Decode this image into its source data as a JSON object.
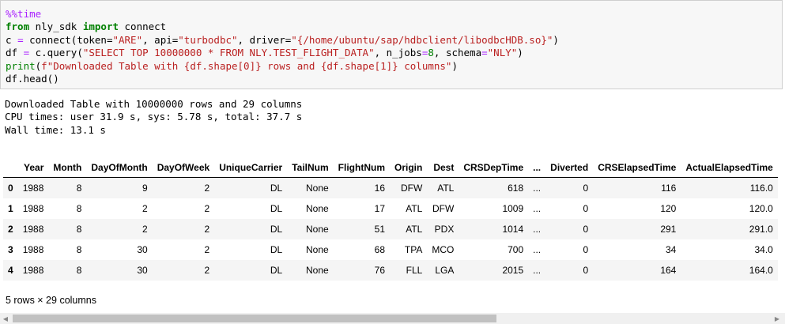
{
  "code": {
    "magic": "%%time",
    "line2": {
      "kw1": "from",
      "module": " nly_sdk ",
      "kw2": "import",
      "name": " connect"
    },
    "line3": {
      "prefix": "c ",
      "eq": "=",
      "pre": " connect(token=",
      "token": "\"ARE\"",
      "sep1": ", api=",
      "api": "\"turbodbc\"",
      "sep2": ", driver=",
      "driver": "\"{/home/ubuntu/sap/hdbclient/libodbcHDB.so}\"",
      "end": ")"
    },
    "line4": {
      "prefix": "df ",
      "eq": "=",
      "pre": " c.query(",
      "query": "\"SELECT TOP 10000000 * FROM NLY.TEST_FLIGHT_DATA\"",
      "sep1": ", n_jobs",
      "eq2": "=",
      "jobs": "8",
      "sep2": ", schema",
      "eq3": "=",
      "schema": "\"NLY\"",
      "end": ")"
    },
    "line5": {
      "fn": "print",
      "open": "(",
      "fstr": "f\"Downloaded Table with {df.shape[0]} rows and {df.shape[1]} columns\"",
      "end": ")"
    },
    "line6": "df.head()"
  },
  "output_lines": [
    "Downloaded Table with 10000000 rows and 29 columns",
    "CPU times: user 31.9 s, sys: 5.78 s, total: 37.7 s",
    "Wall time: 13.1 s"
  ],
  "table": {
    "columns": [
      "",
      "Year",
      "Month",
      "DayOfMonth",
      "DayOfWeek",
      "UniqueCarrier",
      "TailNum",
      "FlightNum",
      "Origin",
      "Dest",
      "CRSDepTime",
      "...",
      "Diverted",
      "CRSElapsedTime",
      "ActualElapsedTime"
    ],
    "rows": [
      [
        "0",
        "1988",
        "8",
        "9",
        "2",
        "DL",
        "None",
        "16",
        "DFW",
        "ATL",
        "618",
        "...",
        "0",
        "116",
        "116.0"
      ],
      [
        "1",
        "1988",
        "8",
        "2",
        "2",
        "DL",
        "None",
        "17",
        "ATL",
        "DFW",
        "1009",
        "...",
        "0",
        "120",
        "120.0"
      ],
      [
        "2",
        "1988",
        "8",
        "2",
        "2",
        "DL",
        "None",
        "51",
        "ATL",
        "PDX",
        "1014",
        "...",
        "0",
        "291",
        "291.0"
      ],
      [
        "3",
        "1988",
        "8",
        "30",
        "2",
        "DL",
        "None",
        "68",
        "TPA",
        "MCO",
        "700",
        "...",
        "0",
        "34",
        "34.0"
      ],
      [
        "4",
        "1988",
        "8",
        "30",
        "2",
        "DL",
        "None",
        "76",
        "FLL",
        "LGA",
        "2015",
        "...",
        "0",
        "164",
        "164.0"
      ]
    ]
  },
  "footer": "5 rows × 29 columns",
  "scrollbar": {
    "left_arrow": "◀",
    "right_arrow": "▶"
  }
}
